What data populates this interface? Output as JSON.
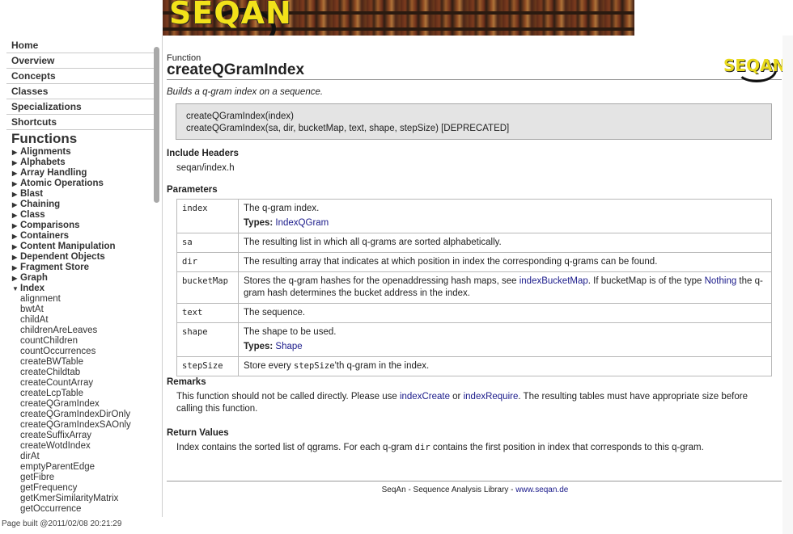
{
  "sidebar": {
    "nav": [
      "Home",
      "Overview",
      "Concepts",
      "Classes",
      "Specializations",
      "Shortcuts"
    ],
    "functions_title": "Functions",
    "categories": [
      "Alignments",
      "Alphabets",
      "Array Handling",
      "Atomic Operations",
      "Blast",
      "Chaining",
      "Class",
      "Comparisons",
      "Containers",
      "Content Manipulation",
      "Dependent Objects",
      "Fragment Store",
      "Graph"
    ],
    "expanded_category": "Index",
    "index_items": [
      "alignment",
      "bwtAt",
      "childAt",
      "childrenAreLeaves",
      "countChildren",
      "countOccurrences",
      "createBWTable",
      "createChildtab",
      "createCountArray",
      "createLcpTable",
      "createQGramIndex",
      "createQGramIndexDirOnly",
      "createQGramIndexSAOnly",
      "createSuffixArray",
      "createWotdIndex",
      "dirAt",
      "emptyParentEdge",
      "getFibre",
      "getFrequency",
      "getKmerSimilarityMatrix",
      "getOccurrence"
    ],
    "built": "Page built @2011/02/08 20:21:29"
  },
  "banner": {
    "logo_text": "SEQAN"
  },
  "main": {
    "kind": "Function",
    "title": "createQGramIndex",
    "logo_text": "SEQAN",
    "brief": "Builds a q-gram index on a sequence.",
    "signatures": [
      "createQGramIndex(index)",
      "createQGramIndex(sa, dir, bucketMap, text, shape, stepSize) [DEPRECATED]"
    ],
    "include_heading": "Include Headers",
    "include_file": "seqan/index.h",
    "params_heading": "Parameters",
    "types_label": "Types:",
    "params": {
      "index": {
        "name": "index",
        "desc": "The q-gram index.",
        "type": "IndexQGram"
      },
      "sa": {
        "name": "sa",
        "desc": "The resulting list in which all q-grams are sorted alphabetically."
      },
      "dir": {
        "name": "dir",
        "desc": "The resulting array that indicates at which position in index the corresponding q-grams can be found."
      },
      "bucketMap": {
        "name": "bucketMap",
        "desc1": "Stores the q-gram hashes for the openaddressing hash maps, see ",
        "link1": "indexBucketMap",
        "desc2": ". If bucketMap is of the type ",
        "link2": "Nothing",
        "desc3": " the q-gram hash determines the bucket address in the index."
      },
      "text": {
        "name": "text",
        "desc": "The sequence."
      },
      "shape": {
        "name": "shape",
        "desc": "The shape to be used.",
        "type": "Shape"
      },
      "stepSize": {
        "name": "stepSize",
        "desc1": "Store every ",
        "code": "stepSize",
        "desc2": "'th q-gram in the index."
      }
    },
    "remarks_heading": "Remarks",
    "remarks": {
      "t1": "This function should not be called directly. Please use ",
      "link1": "indexCreate",
      "t2": " or ",
      "link2": "indexRequire",
      "t3": ". The resulting tables must have appropriate size before calling this function."
    },
    "return_heading": "Return Values",
    "return": {
      "t1": "Index contains the sorted list of qgrams. For each q-gram ",
      "code": "dir",
      "t2": " contains the first position in index that corresponds to this q-gram."
    },
    "footer_text": "SeqAn - Sequence Analysis Library - ",
    "footer_link": "www.seqan.de"
  }
}
